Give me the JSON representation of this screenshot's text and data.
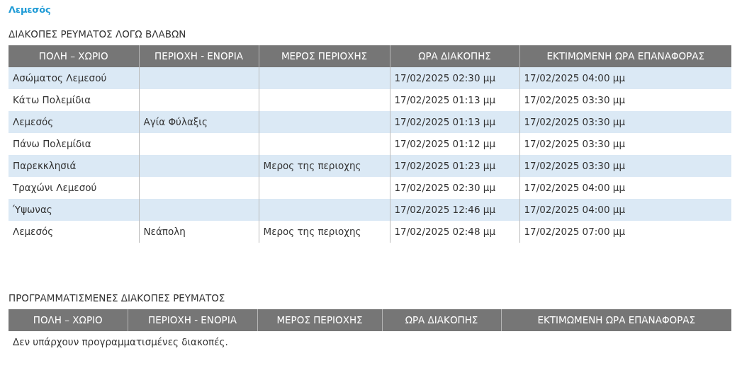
{
  "location_link": "Λεμεσός",
  "fault_outages": {
    "title": "ΔΙΑΚΟΠΕΣ ΡΕΥΜΑΤΟΣ ΛΟΓΩ ΒΛΑΒΩΝ",
    "columns": [
      "ΠΟΛΗ – ΧΩΡΙΟ",
      "ΠΕΡΙΟΧΗ - ΕΝΟΡΙΑ",
      "ΜΕΡΟΣ ΠΕΡΙΟΧΗΣ",
      "ΩΡΑ ΔΙΑΚΟΠΗΣ",
      "ΕΚΤΙΜΩΜΕΝΗ ΩΡΑ ΕΠΑΝΑΦΟΡΑΣ"
    ],
    "rows": [
      {
        "city": "Ασώματος Λεμεσού",
        "start": "17/02/2025 02:30 μμ",
        "restore": "17/02/2025 04:00 μμ"
      },
      {
        "city": "Κάτω Πολεμίδια",
        "start": "17/02/2025 01:13 μμ",
        "restore": "17/02/2025 03:30 μμ"
      },
      {
        "city": "Λεμεσός",
        "area": "Αγία Φύλαξις",
        "start": "17/02/2025 01:13 μμ",
        "restore": "17/02/2025 03:30 μμ"
      },
      {
        "city": "Πάνω Πολεμίδια",
        "start": "17/02/2025 01:12 μμ",
        "restore": "17/02/2025 03:30 μμ"
      },
      {
        "city": "Παρεκκλησιά",
        "part": "Μερος της περιοχης",
        "start": "17/02/2025 01:23 μμ",
        "restore": "17/02/2025 03:30 μμ"
      },
      {
        "city": "Τραχώνι Λεμεσού",
        "start": "17/02/2025 02:30 μμ",
        "restore": "17/02/2025 04:00 μμ"
      },
      {
        "city": "Ύψωνας",
        "start": "17/02/2025 12:46 μμ",
        "restore": "17/02/2025 04:00 μμ"
      },
      {
        "city": "Λεμεσός",
        "area": "Νεάπολη",
        "part": "Μερος της περιοχης",
        "start": "17/02/2025 02:48 μμ",
        "restore": "17/02/2025 07:00 μμ"
      }
    ]
  },
  "planned_outages": {
    "title": "ΠΡΟΓΡΑΜΜΑΤΙΣΜΕΝΕΣ ΔΙΑΚΟΠΕΣ ΡΕΥΜΑΤΟΣ",
    "columns": [
      "ΠΟΛΗ – ΧΩΡΙΟ",
      "ΠΕΡΙΟΧΗ - ΕΝΟΡΙΑ",
      "ΜΕΡΟΣ ΠΕΡΙΟΧΗΣ",
      "ΩΡΑ ΔΙΑΚΟΠΗΣ",
      "ΕΚΤΙΜΩΜΕΝΗ ΩΡΑ ΕΠΑΝΑΦΟΡΑΣ"
    ],
    "empty_message": "Δεν υπάρχουν προγραμματισμένες διακοπές."
  }
}
